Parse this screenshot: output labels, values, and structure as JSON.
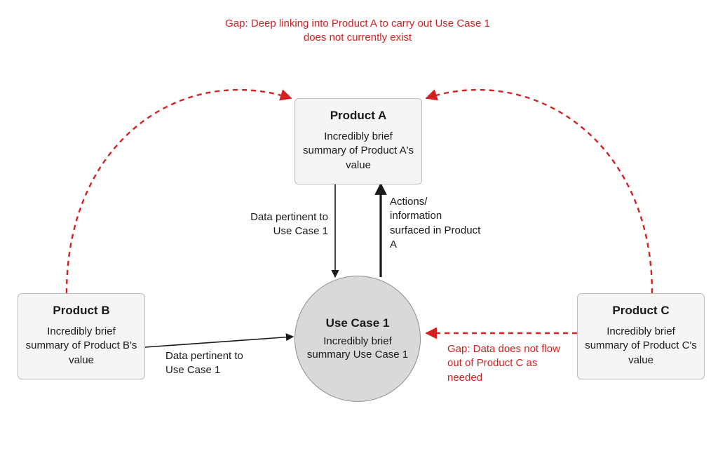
{
  "gap_top": "Gap: Deep linking into Product A to carry out Use Case 1 does not currently exist",
  "product_a": {
    "title": "Product A",
    "desc": "Incredibly brief summary of Product A's value"
  },
  "product_b": {
    "title": "Product B",
    "desc": "Incredibly brief summary of Product B's value"
  },
  "product_c": {
    "title": "Product C",
    "desc": "Incredibly brief summary of Product C's value"
  },
  "use_case": {
    "title": "Use Case 1",
    "desc": "Incredibly brief summary Use Case 1"
  },
  "edge_a_to_uc": "Data pertinent to Use Case 1",
  "edge_uc_to_a": "Actions/ information surfaced in Product A",
  "edge_b_to_uc": "Data pertinent to Use Case 1",
  "gap_c": "Gap: Data does not flow out of Product C as needed",
  "colors": {
    "gap": "#d32020",
    "node_fill": "#f5f5f5",
    "node_stroke": "#bdbdbd",
    "circle_fill": "#d9d9d9",
    "circle_stroke": "#8f8f8f",
    "line": "#1a1a1a"
  }
}
